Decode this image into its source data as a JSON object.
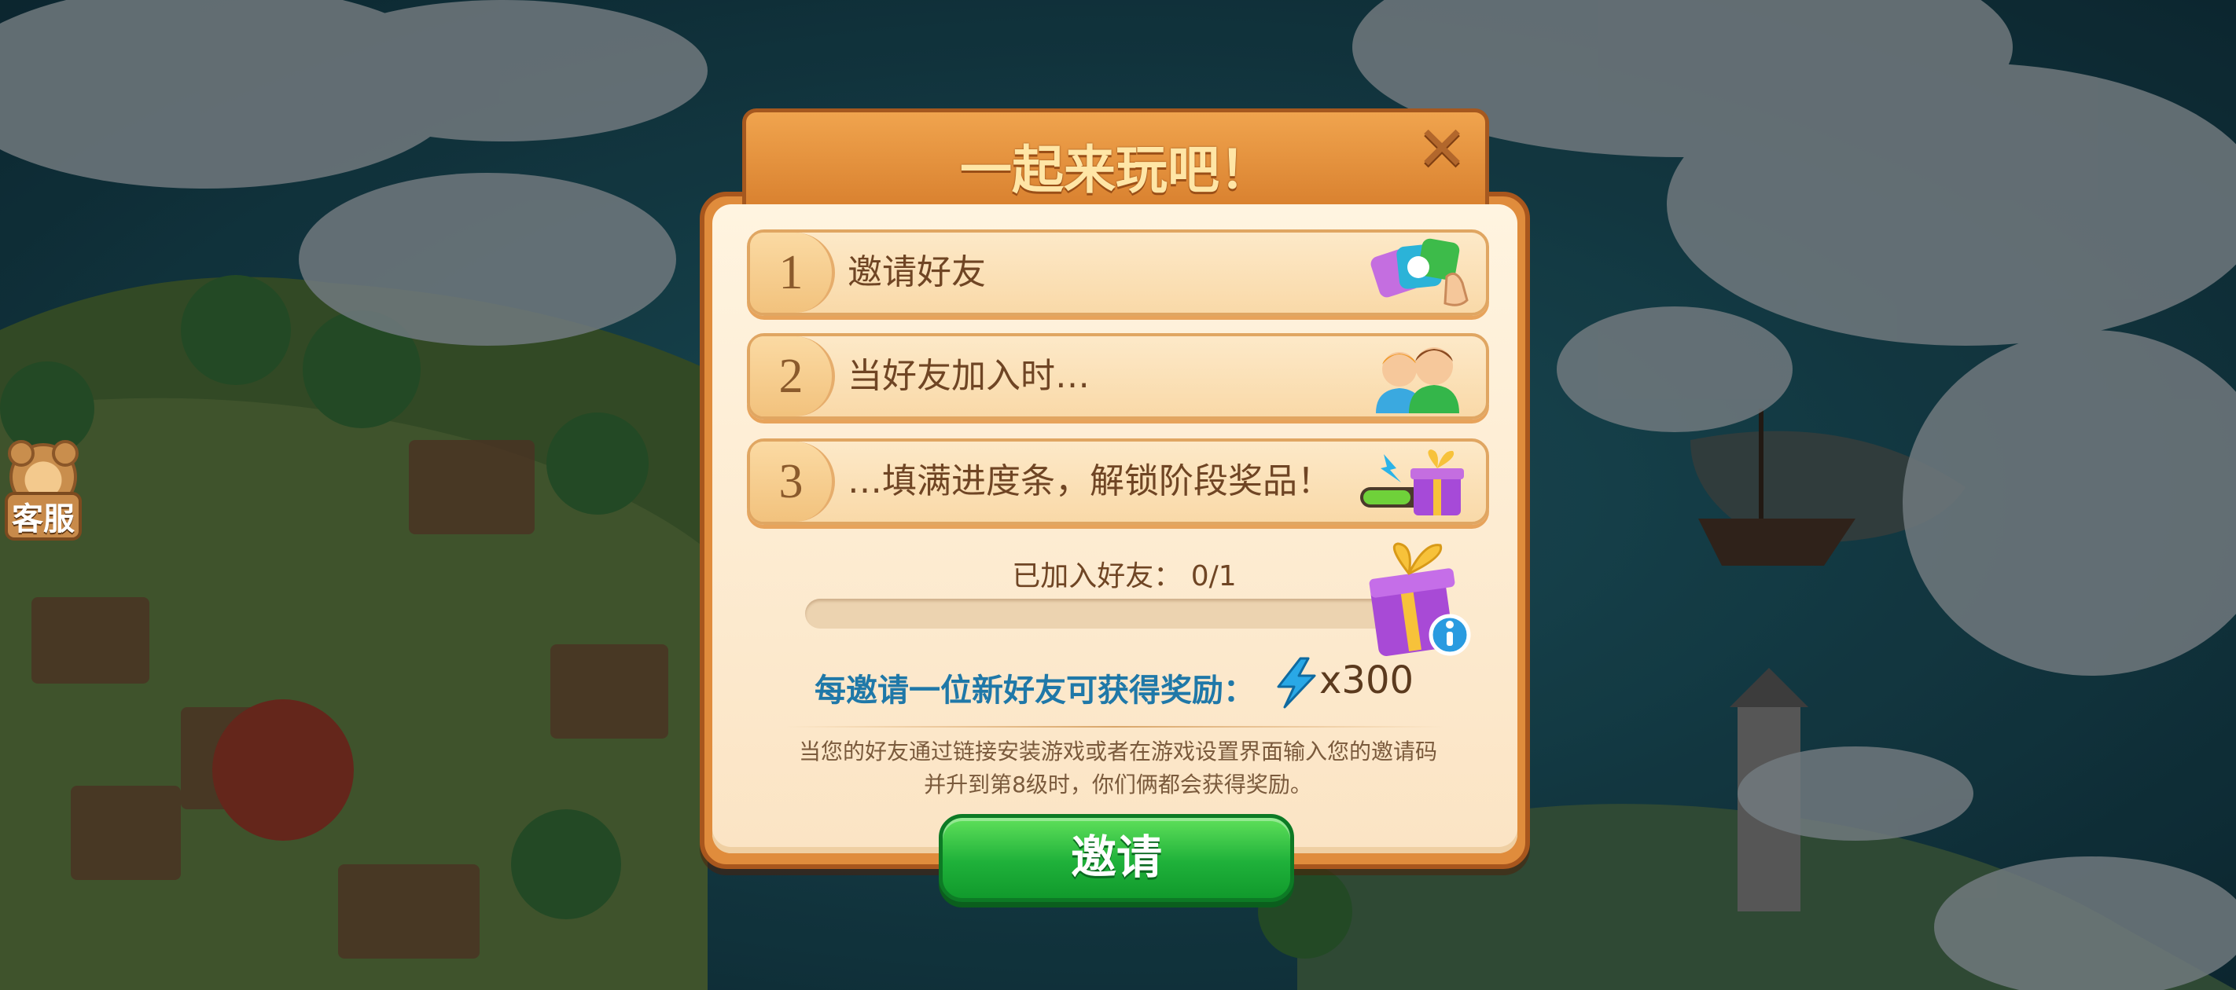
{
  "dialog": {
    "title": "一起来玩吧！",
    "steps": [
      {
        "number": "1",
        "text": "邀请好友",
        "icon": "invite-cards-icon"
      },
      {
        "number": "2",
        "text": "当好友加入时…",
        "icon": "friends-icon"
      },
      {
        "number": "3",
        "text": "…填满进度条，解锁阶段奖品！",
        "icon": "progress-gift-icon"
      }
    ],
    "joined_label": "已加入好友： 0/1",
    "progress_fraction": 0,
    "reward_label": "每邀请一位新好友可获得奖励：",
    "reward_amount": "x300",
    "description_line1": "当您的好友通过链接安装游戏或者在游戏设置界面输入您的邀请码",
    "description_line2": "并升到第8级时，你们俩都会获得奖励。",
    "invite_label": "邀请"
  },
  "side": {
    "customer_service_label": "客服"
  },
  "colors": {
    "panel_orange": "#e08c3c",
    "invite_green": "#1fb13a",
    "reward_blue": "#1f78a8",
    "title_yellow": "#ffe6a6"
  }
}
